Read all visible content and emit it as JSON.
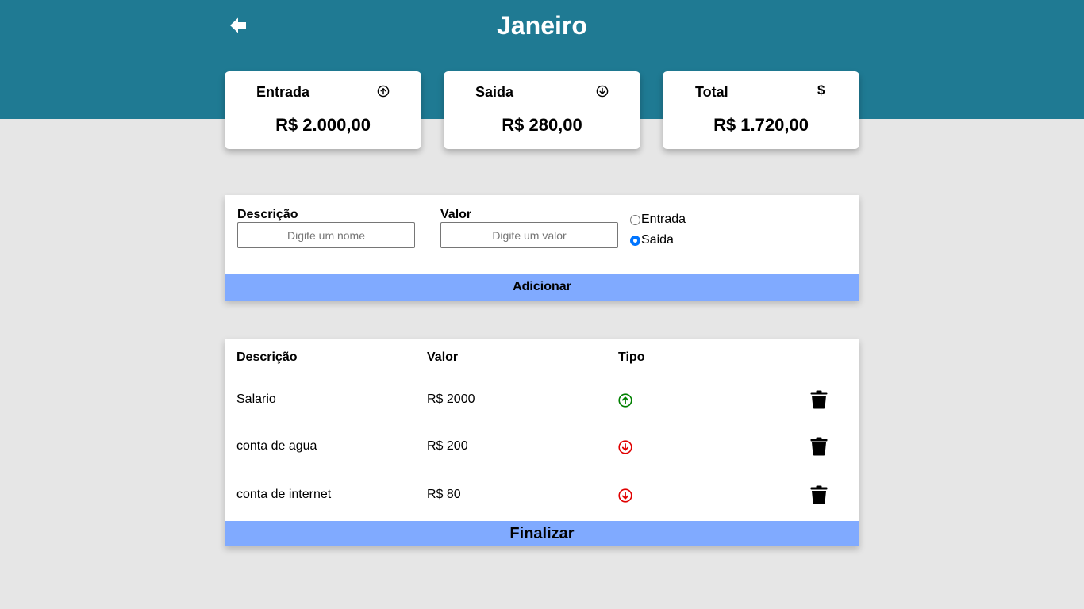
{
  "header": {
    "title": "Janeiro",
    "back_icon": "arrow-left-icon",
    "background": "#1f7a93"
  },
  "summary": [
    {
      "title": "Entrada",
      "icon": "arrow-up-circle-icon",
      "value": "R$ 2.000,00"
    },
    {
      "title": "Saida",
      "icon": "arrow-down-circle-icon",
      "value": "R$ 280,00"
    },
    {
      "title": "Total",
      "icon": "$",
      "value": "R$ 1.720,00"
    }
  ],
  "form": {
    "description_label": "Descrição",
    "description_placeholder": "Digite um nome",
    "description_value": "",
    "value_label": "Valor",
    "value_placeholder": "Digite um valor",
    "value_value": "",
    "type_options": [
      {
        "label": "Entrada",
        "checked": false
      },
      {
        "label": "Saida",
        "checked": true
      }
    ],
    "add_label": "Adicionar",
    "button_color": "#80aaff"
  },
  "table": {
    "headers": [
      "Descrição",
      "Valor",
      "Tipo"
    ],
    "rows": [
      {
        "description": "Salario",
        "value": "R$ 2000",
        "type": "entrada",
        "type_icon": "arrow-up-circle-icon",
        "type_color": "#008000"
      },
      {
        "description": "conta de agua",
        "value": "R$ 200",
        "type": "saida",
        "type_icon": "arrow-down-circle-icon",
        "type_color": "#e00000"
      },
      {
        "description": "conta de internet",
        "value": "R$ 80",
        "type": "saida",
        "type_icon": "arrow-down-circle-icon",
        "type_color": "#e00000"
      }
    ],
    "delete_icon": "trash-icon",
    "finish_label": "Finalizar"
  }
}
